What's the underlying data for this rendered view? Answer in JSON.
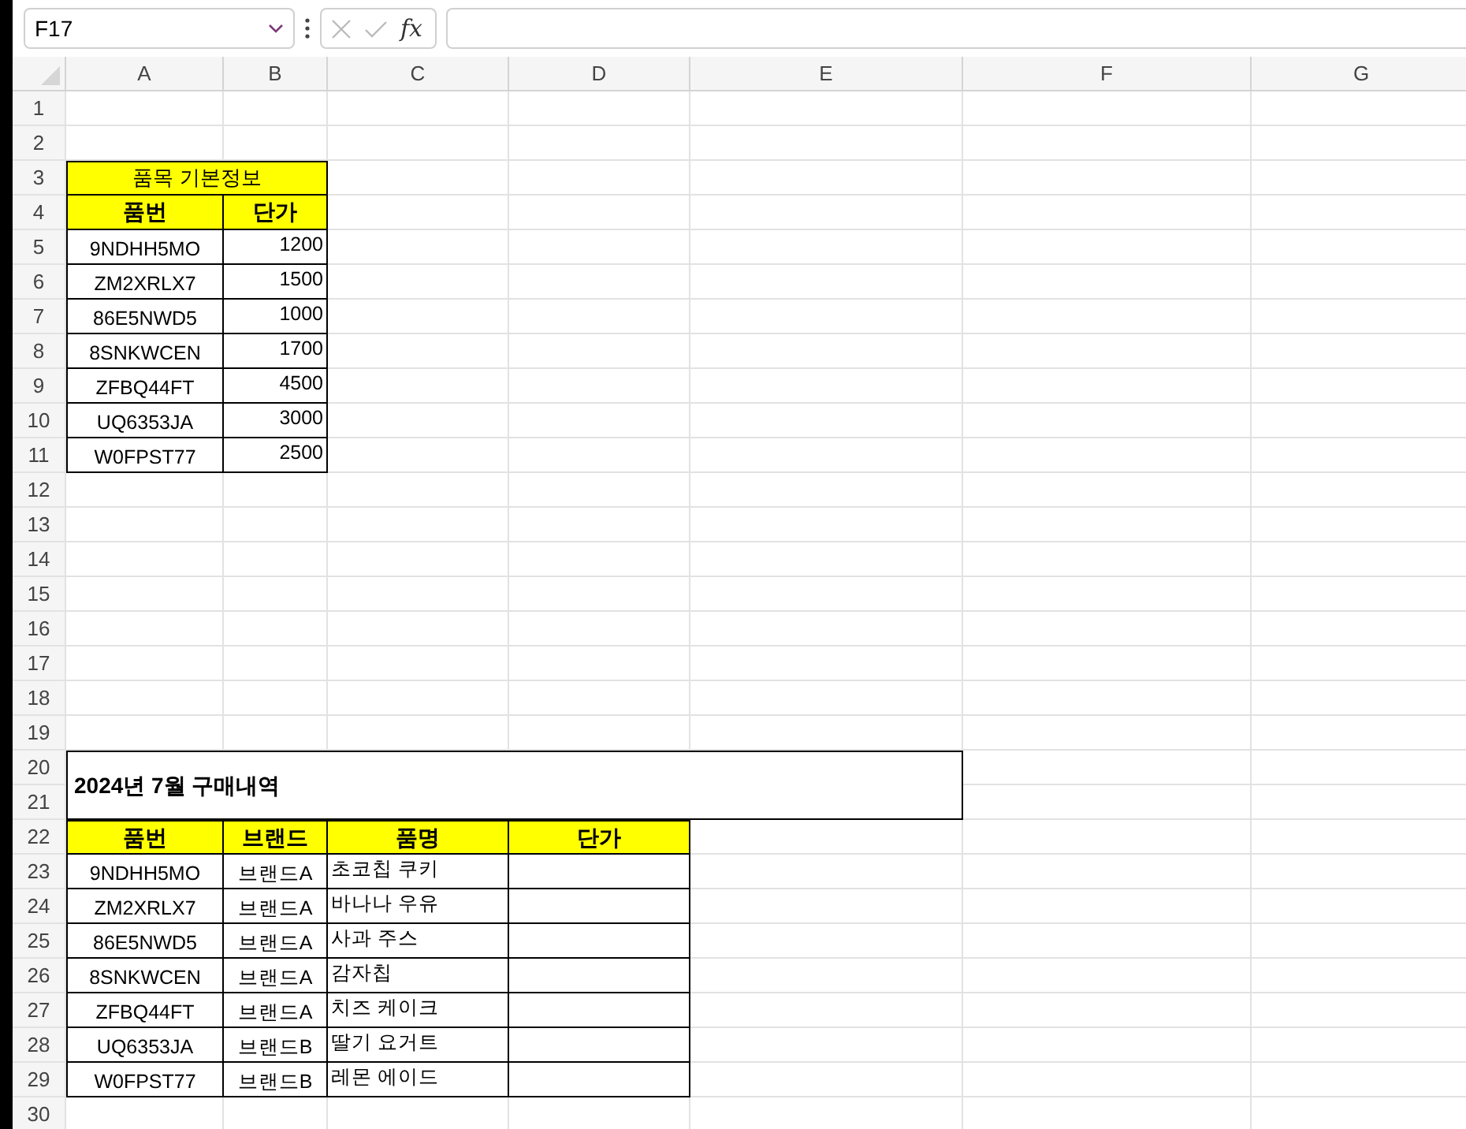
{
  "formula_bar": {
    "name_box": "F17",
    "function_label": "fx"
  },
  "columns": [
    "A",
    "B",
    "C",
    "D",
    "E",
    "F",
    "G"
  ],
  "rows": [
    "1",
    "2",
    "3",
    "4",
    "5",
    "6",
    "7",
    "8",
    "9",
    "10",
    "11",
    "12",
    "13",
    "14",
    "15",
    "16",
    "17",
    "18",
    "19",
    "20",
    "21",
    "22",
    "23",
    "24",
    "25",
    "26",
    "27",
    "28",
    "29",
    "30"
  ],
  "item_table": {
    "title": "품목 기본정보",
    "headers": [
      "품번",
      "단가"
    ],
    "rows": [
      {
        "part_no": "9NDHH5MO",
        "price": "1200"
      },
      {
        "part_no": "ZM2XRLX7",
        "price": "1500"
      },
      {
        "part_no": "86E5NWD5",
        "price": "1000"
      },
      {
        "part_no": "8SNKWCEN",
        "price": "1700"
      },
      {
        "part_no": "ZFBQ44FT",
        "price": "4500"
      },
      {
        "part_no": "UQ6353JA",
        "price": "3000"
      },
      {
        "part_no": "W0FPST77",
        "price": "2500"
      }
    ]
  },
  "purchase_table": {
    "title": "2024년 7월 구매내역",
    "headers": [
      "품번",
      "브랜드",
      "품명",
      "단가"
    ],
    "rows": [
      {
        "part_no": "9NDHH5MO",
        "brand": "브랜드A",
        "product": "초코칩 쿠키"
      },
      {
        "part_no": "ZM2XRLX7",
        "brand": "브랜드A",
        "product": "바나나 우유"
      },
      {
        "part_no": "86E5NWD5",
        "brand": "브랜드A",
        "product": "사과 주스"
      },
      {
        "part_no": "8SNKWCEN",
        "brand": "브랜드A",
        "product": "감자칩"
      },
      {
        "part_no": "ZFBQ44FT",
        "brand": "브랜드A",
        "product": "치즈 케이크"
      },
      {
        "part_no": "UQ6353JA",
        "brand": "브랜드B",
        "product": "딸기 요거트"
      },
      {
        "part_no": "W0FPST77",
        "brand": "브랜드B",
        "product": "레몬 에이드"
      }
    ]
  }
}
